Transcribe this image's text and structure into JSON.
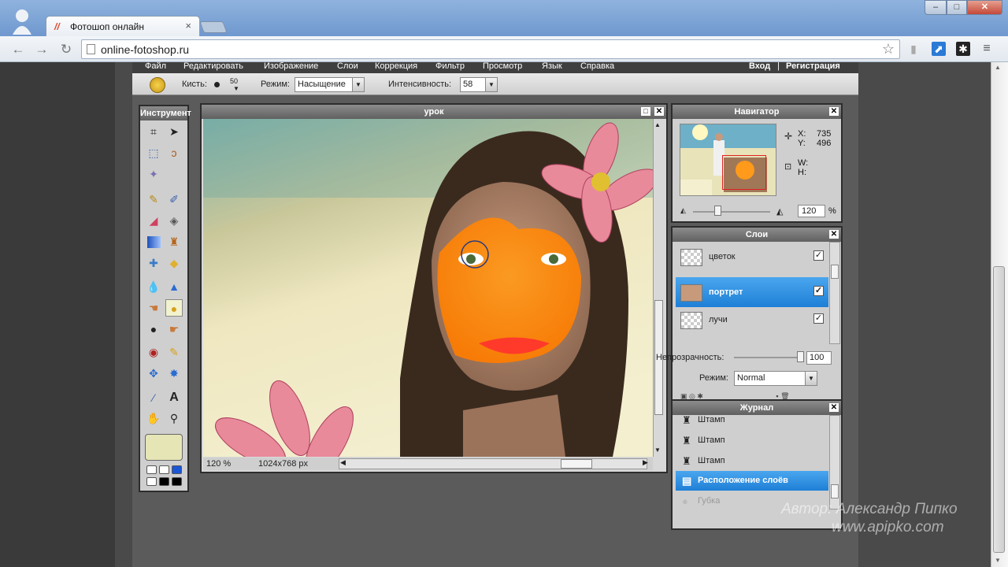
{
  "browser": {
    "tab_title": "Фотошоп онлайн",
    "url": "online-fotoshop.ru",
    "window_controls": {
      "minimize": "–",
      "maximize": "□",
      "close": "✕"
    }
  },
  "menu": {
    "items": [
      "Файл",
      "Редактировать",
      "Изображение",
      "Слои",
      "Коррекция",
      "Фильтр",
      "Просмотр",
      "Язык",
      "Справка"
    ],
    "login": "Вход",
    "separator": "|",
    "register": "Регистрация"
  },
  "options_bar": {
    "brush_label": "Кисть:",
    "brush_size": "50",
    "mode_label": "Режим:",
    "mode_value": "Насыщение",
    "intensity_label": "Интенсивность:",
    "intensity_value": "58"
  },
  "tools_panel": {
    "title": "Инструмент",
    "color": "#e6e5b6"
  },
  "document": {
    "title": "урок",
    "zoom": "120 %",
    "size": "1024x768 px"
  },
  "navigator": {
    "title": "Навигатор",
    "x_label": "X:",
    "x_value": "735",
    "y_label": "Y:",
    "y_value": "496",
    "w_label": "W:",
    "h_label": "H:",
    "zoom_value": "120",
    "zoom_unit": "%"
  },
  "layers": {
    "title": "Слои",
    "items": [
      {
        "name": "цветок",
        "visible": "✓"
      },
      {
        "name": "портрет",
        "visible": "✓"
      },
      {
        "name": "лучи",
        "visible": "✓"
      }
    ],
    "opacity_label": "Непрозрачность:",
    "opacity_value": "100",
    "mode_label": "Режим:",
    "mode_value": "Normal"
  },
  "history": {
    "title": "Журнал",
    "items": [
      "Штамп",
      "Штамп",
      "Штамп",
      "Расположение слоёв",
      "Губка"
    ]
  },
  "watermark": {
    "line1": "Автор: Александр Пипко",
    "line2": "www.apipko.com"
  }
}
